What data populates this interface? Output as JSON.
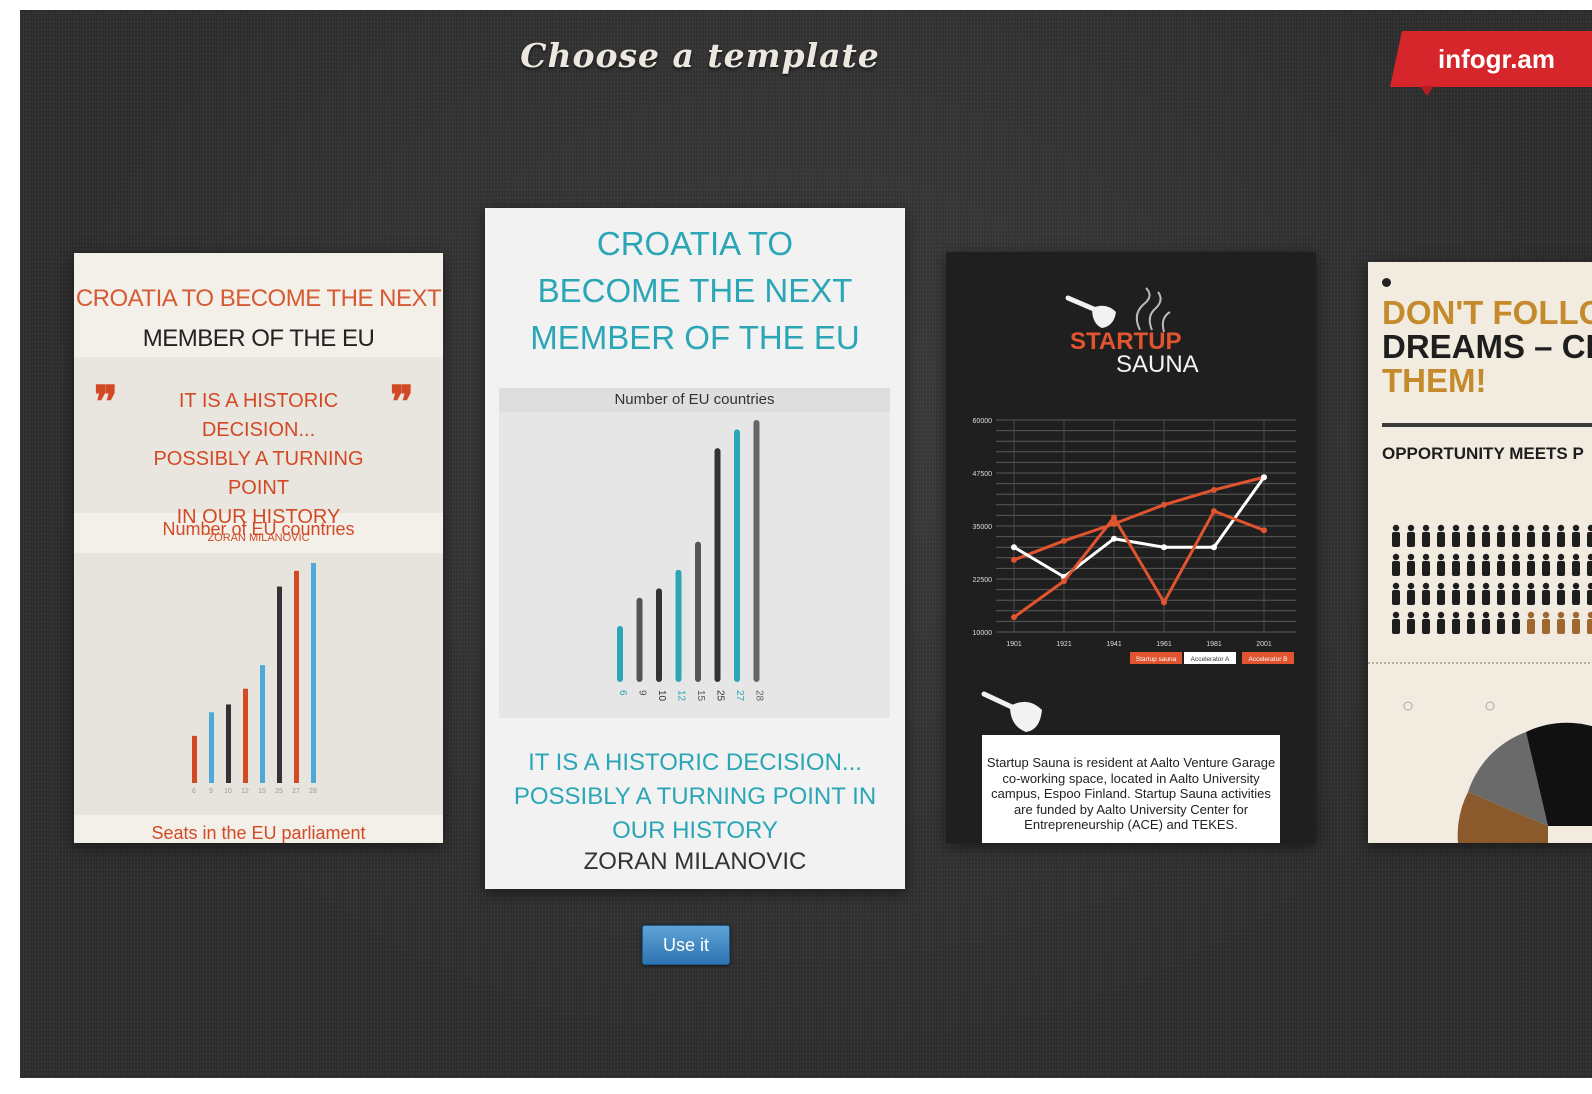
{
  "header": {
    "title": "Choose a template",
    "brand": "infogr.am"
  },
  "templates": [
    {
      "title_line1": "CROATIA TO BECOME THE NEXT",
      "title_line2": "MEMBER OF THE EU",
      "quote_lines": [
        "IT IS A HISTORIC DECISION...",
        "POSSIBLY A TURNING POINT",
        "IN OUR HISTORY"
      ],
      "quote_author": "ZORAN MILANOVIC",
      "chart_title": "Number of EU countries",
      "footer": "Seats in the EU parliament"
    },
    {
      "title_lines": [
        "CROATIA TO",
        "BECOME THE NEXT",
        "MEMBER OF THE EU"
      ],
      "chart_title": "Number of EU countries",
      "quote_lines": [
        "IT IS A HISTORIC DECISION...",
        "POSSIBLY A TURNING POINT IN",
        "OUR HISTORY"
      ],
      "author": "ZORAN MILANOVIC"
    },
    {
      "logo_top": "STARTUP",
      "logo_bottom": "SAUNA",
      "description": "Startup Sauna is resident at Aalto Venture Garage co-working space, located in Aalto University campus, Espoo Finland. Startup Sauna activities are funded by Aalto University Center for Entrepreneurship (ACE) and TEKES."
    },
    {
      "title_lines": [
        "DON'T FOLLO",
        "DREAMS – CH",
        "THEM!"
      ],
      "subtitle": "OPPORTUNITY MEETS P"
    }
  ],
  "actions": {
    "use_label": "Use it"
  },
  "chart_data": [
    {
      "type": "bar",
      "title": "Number of EU countries",
      "categories": [
        "6",
        "9",
        "10",
        "12",
        "15",
        "25",
        "27",
        "28"
      ],
      "values": [
        6,
        9,
        10,
        12,
        15,
        25,
        27,
        28
      ],
      "colors": [
        "#d24a25",
        "#4ea9d6",
        "#333333",
        "#d24a25",
        "#4ea9d6",
        "#333333",
        "#d24a25",
        "#4ea9d6"
      ]
    },
    {
      "type": "bar",
      "title": "Number of EU countries",
      "categories": [
        "6",
        "9",
        "10",
        "12",
        "15",
        "25",
        "27",
        "28"
      ],
      "values": [
        6,
        9,
        10,
        12,
        15,
        25,
        27,
        28
      ],
      "colors": [
        "#2aa6b6",
        "#555555",
        "#333333",
        "#2aa6b6",
        "#555555",
        "#333333",
        "#2aa6b6",
        "#666666"
      ]
    },
    {
      "type": "line",
      "x": [
        "1901",
        "1921",
        "1941",
        "1961",
        "1981",
        "2001"
      ],
      "yticks": [
        "60000",
        "47500",
        "35000",
        "22500",
        "10000"
      ],
      "ylim": [
        10000,
        60000
      ],
      "series": [
        {
          "name": "Startup sauna",
          "color": "#e0542f",
          "values": [
            27000,
            31500,
            35500,
            40000,
            43500,
            46500
          ]
        },
        {
          "name": "Accelerator A",
          "color": "#ffffff",
          "values": [
            30000,
            23000,
            32000,
            30000,
            30000,
            46500
          ]
        },
        {
          "name": "Accelerator B",
          "color": "#e0542f",
          "values": [
            13500,
            22000,
            37000,
            17000,
            38500,
            34000
          ]
        }
      ]
    }
  ]
}
